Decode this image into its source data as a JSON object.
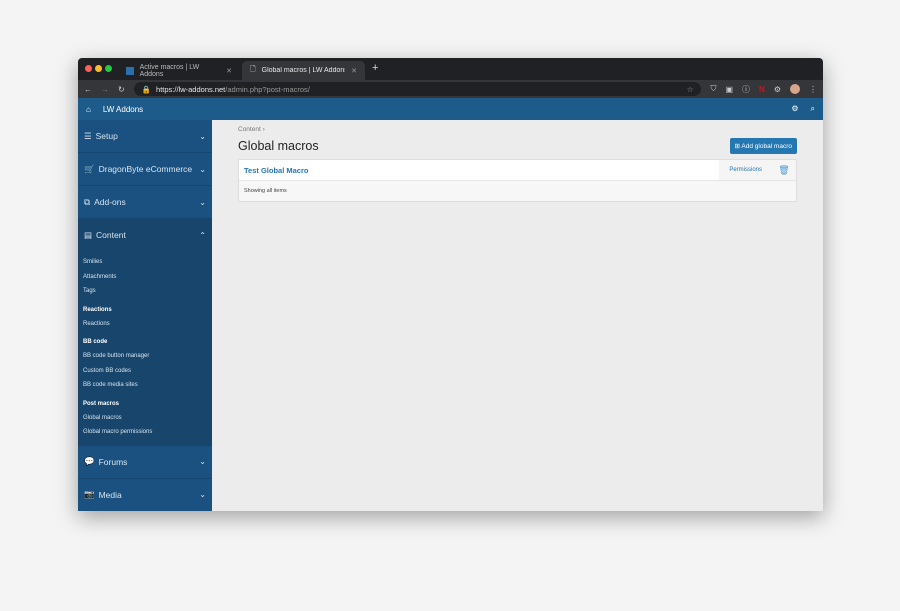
{
  "browser": {
    "tabs": [
      {
        "label": "Active macros | LW Addons"
      },
      {
        "label": "Global macros | LW Addons - A"
      }
    ],
    "url_host": "https://lw-addons.net",
    "url_path": "/admin.php?post-macros/"
  },
  "header": {
    "title": "LW Addons"
  },
  "sidebar": {
    "sections": [
      {
        "label": "Setup"
      },
      {
        "label": "DragonByte eCommerce"
      },
      {
        "label": "Add-ons"
      },
      {
        "label": "Content"
      },
      {
        "label": "Forums"
      },
      {
        "label": "Media"
      }
    ],
    "content_items": [
      "Smilies",
      "Attachments",
      "Tags"
    ],
    "groups": [
      {
        "heading": "Reactions",
        "items": [
          "Reactions"
        ]
      },
      {
        "heading": "BB code",
        "items": [
          "BB code button manager",
          "Custom BB codes",
          "BB code media sites"
        ]
      },
      {
        "heading": "Post macros",
        "items": [
          "Global macros",
          "Global macro permissions"
        ]
      }
    ]
  },
  "main": {
    "breadcrumb": "Content",
    "title": "Global macros",
    "add_button": "Add global macro",
    "rows": [
      {
        "name": "Test Global Macro",
        "permissions": "Permissions"
      }
    ],
    "footer": "Showing all items"
  },
  "colors": {
    "header": "#1d5b8a",
    "sidebar": "#1b5180",
    "accent": "#2577b1"
  }
}
